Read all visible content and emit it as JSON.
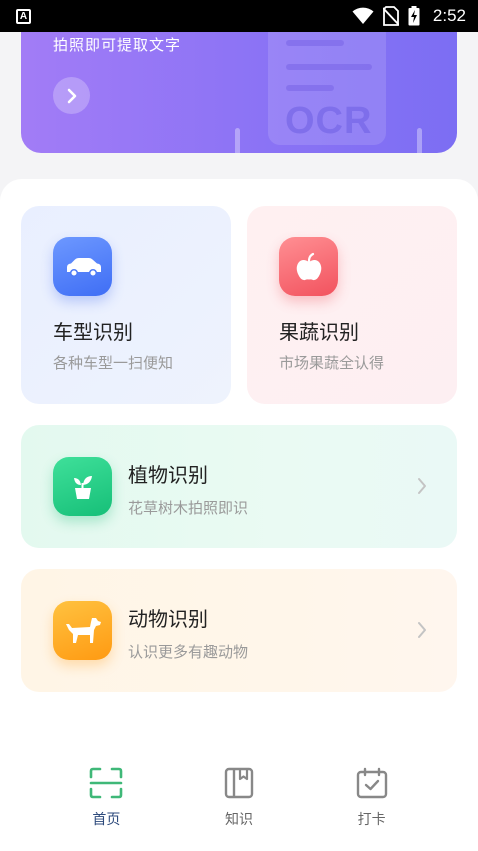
{
  "status_bar": {
    "app_icon_letter": "A",
    "time": "2:52"
  },
  "banner": {
    "subtitle": "拍照即可提取文字",
    "doc_text": "OCR",
    "gradient": [
      "#a27cf6",
      "#7c6ef3"
    ]
  },
  "cards": {
    "car": {
      "title": "车型识别",
      "desc": "各种车型一扫便知",
      "icon": "car-icon"
    },
    "fruit": {
      "title": "果蔬识别",
      "desc": "市场果蔬全认得",
      "icon": "apple-icon"
    },
    "plant": {
      "title": "植物识别",
      "desc": "花草树木拍照即识",
      "icon": "plant-pot-icon"
    },
    "animal": {
      "title": "动物识别",
      "desc": "认识更多有趣动物",
      "icon": "dog-icon"
    }
  },
  "bottom_nav": {
    "items": [
      {
        "label": "首页",
        "icon": "scan-icon",
        "active": true
      },
      {
        "label": "知识",
        "icon": "book-icon",
        "active": false
      },
      {
        "label": "打卡",
        "icon": "calendar-check-icon",
        "active": false
      }
    ],
    "active_color": "#3fb878"
  }
}
